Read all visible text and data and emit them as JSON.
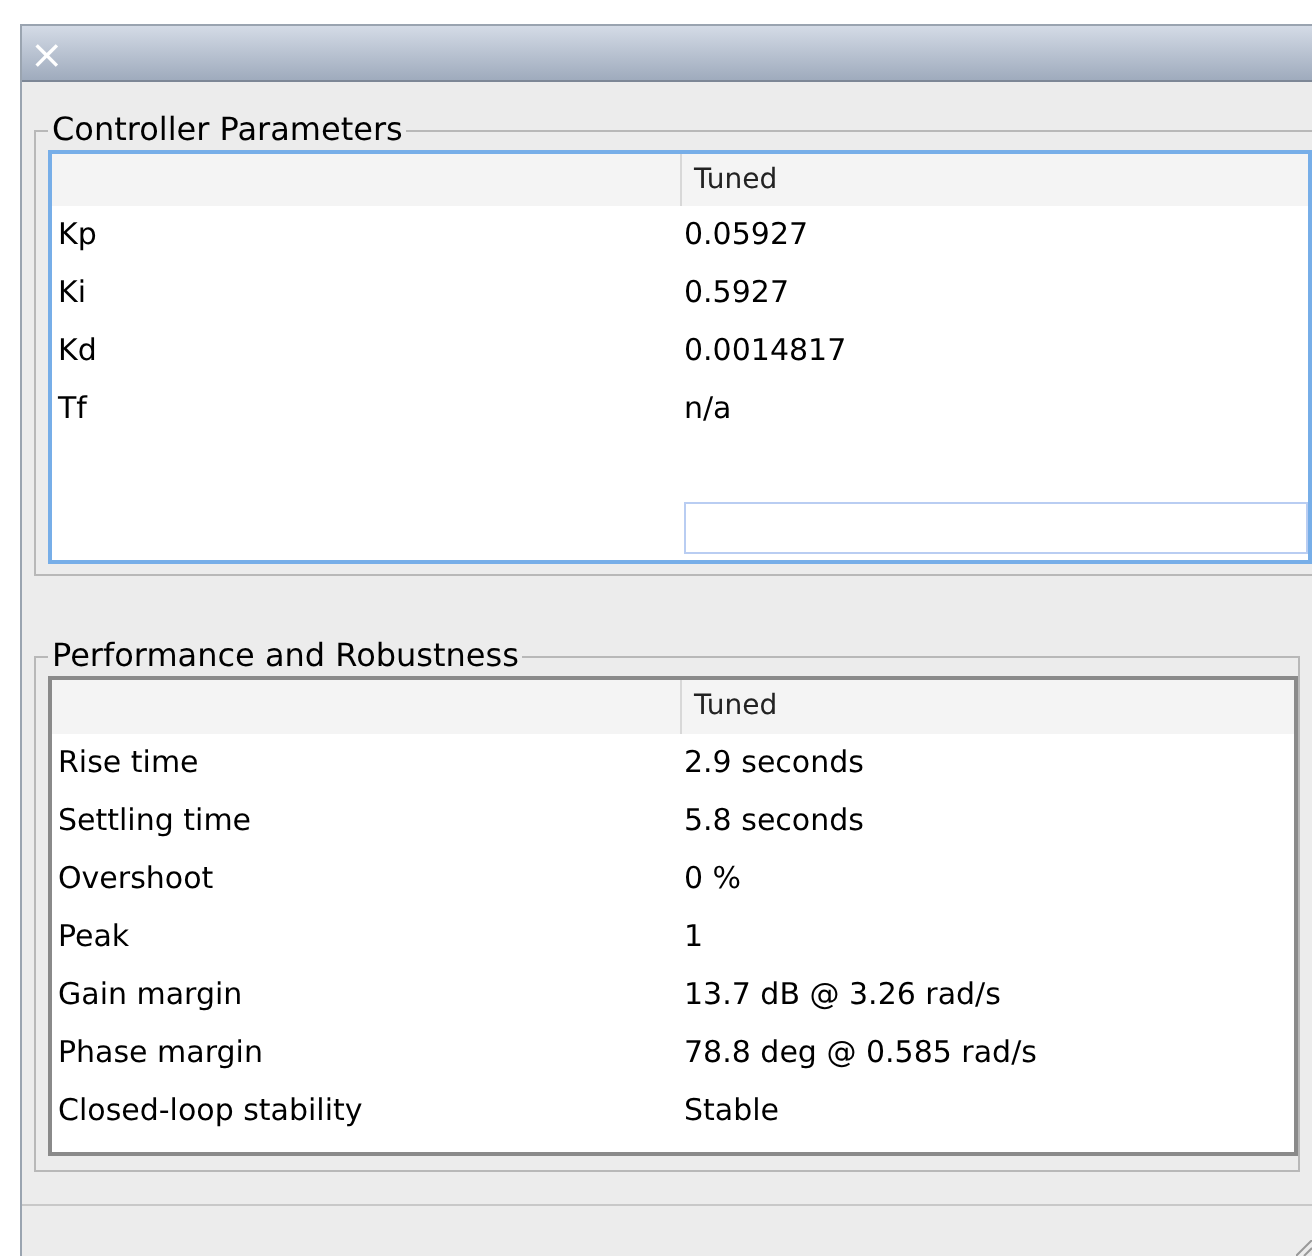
{
  "window": {
    "close_glyph": "×"
  },
  "controller_parameters": {
    "title": "Controller Parameters",
    "columns": [
      "Tuned"
    ],
    "rows": [
      {
        "label": "Kp",
        "value": "0.05927"
      },
      {
        "label": "Ki",
        "value": "0.5927"
      },
      {
        "label": "Kd",
        "value": "0.0014817"
      },
      {
        "label": "Tf",
        "value": "n/a"
      }
    ]
  },
  "performance": {
    "title": "Performance and Robustness",
    "columns": [
      "Tuned"
    ],
    "rows": [
      {
        "label": "Rise time",
        "value": "2.9 seconds"
      },
      {
        "label": "Settling time",
        "value": "5.8 seconds"
      },
      {
        "label": "Overshoot",
        "value": "0 %"
      },
      {
        "label": "Peak",
        "value": "1"
      },
      {
        "label": "Gain margin",
        "value": "13.7 dB @ 3.26 rad/s"
      },
      {
        "label": "Phase margin",
        "value": "78.8 deg @ 0.585 rad/s"
      },
      {
        "label": "Closed-loop stability",
        "value": "Stable"
      }
    ]
  }
}
